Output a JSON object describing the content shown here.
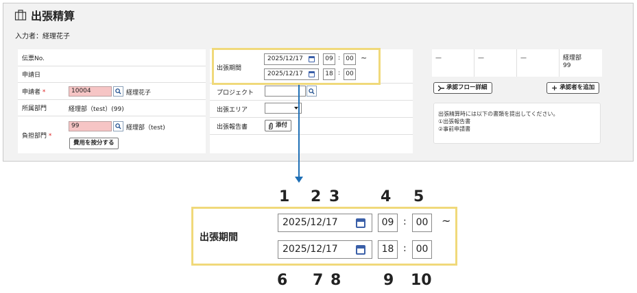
{
  "header": {
    "title": "出張精算",
    "inputter": "入力者：経理花子"
  },
  "form": {
    "slip_no_label": "伝票No.",
    "apply_date_label": "申請日",
    "applicant_label": "申請者",
    "required_mark": "*",
    "applicant_code": "10004",
    "applicant_name": "経理花子",
    "dept_label": "所属部門",
    "dept_value": "経理部（test）(99)",
    "charge_dept_label": "負担部門",
    "charge_dept_code": "99",
    "charge_dept_name": "経理部（test)",
    "split_cost_button": "費用を按分する",
    "trip_period_label": "出張期間",
    "start_date": "2025/12/17",
    "start_hour": "09",
    "start_min": "00",
    "end_date": "2025/12/17",
    "end_hour": "18",
    "end_min": "00",
    "tilde": "~",
    "colon": ":",
    "project_label": "プロジェクト",
    "area_label": "出張エリア",
    "report_label": "出張報告書",
    "attach_button": "添付"
  },
  "approval": {
    "cells": [
      "—",
      "—",
      "—",
      "経理部\n99"
    ],
    "flow_button": "承認フロー詳細",
    "add_button": "承認者を追加",
    "notice_lines": [
      "出張精算時には以下の書類を提出してください。",
      "①出張報告書",
      "②事前申請書"
    ]
  },
  "zoom": {
    "label": "出張期間",
    "start_date": "2025/12/17",
    "start_hour": "09",
    "start_min": "00",
    "end_date": "2025/12/17",
    "end_hour": "18",
    "end_min": "00",
    "tilde": "~",
    "colon": ":",
    "numbers_top": [
      "1",
      "2",
      "3",
      "4",
      "5"
    ],
    "numbers_bottom": [
      "6",
      "7",
      "8",
      "9",
      "10"
    ]
  },
  "colors": {
    "highlight": "#f0d97a",
    "arrow": "#1f6fb5",
    "required_field": "#f6c5c5",
    "calendar_icon": "#3a5fa8"
  }
}
